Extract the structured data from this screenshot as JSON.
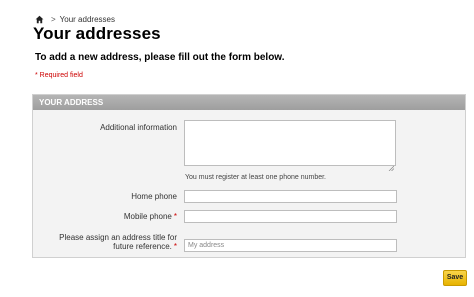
{
  "breadcrumb": {
    "separator": ">",
    "current": "Your addresses"
  },
  "page": {
    "title": "Your addresses",
    "intro": "To add a new address, please fill out the form below.",
    "required_note": "* Required field"
  },
  "panel": {
    "header": "YOUR ADDRESS"
  },
  "form": {
    "additional_info_label": "Additional information",
    "phone_hint": "You must register at least one phone number.",
    "home_phone_label": "Home phone",
    "mobile_phone_label": "Mobile phone",
    "alias_label_line1": "Please assign an address title for",
    "alias_label_line2": "future reference.",
    "alias_placeholder": "My address",
    "required_star": "*"
  },
  "actions": {
    "save_label": "Save"
  },
  "colors": {
    "accent_button": "#f2c21b",
    "required_red": "#cc0000",
    "panel_header": "#a8a8a8"
  },
  "icons": {
    "home": "home-icon",
    "resize": "resize-grip-icon"
  }
}
